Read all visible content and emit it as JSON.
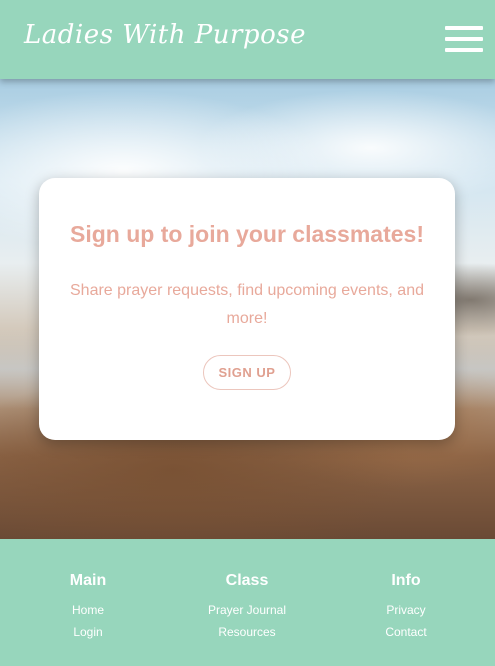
{
  "navbar": {
    "brand": "Ladies With Purpose",
    "menu_icon": "hamburger-menu-icon"
  },
  "hero": {
    "image": "beach-sunset-background"
  },
  "card": {
    "title": "Sign up to join your classmates!",
    "text": "Share prayer requests, find upcoming events, and more!",
    "button_label": "SIGN UP"
  },
  "footer": {
    "columns": [
      {
        "heading": "Main",
        "links": [
          "Home",
          "Login"
        ]
      },
      {
        "heading": "Class",
        "links": [
          "Prayer Journal",
          "Resources"
        ]
      },
      {
        "heading": "Info",
        "links": [
          "Privacy",
          "Contact"
        ]
      }
    ]
  },
  "colors": {
    "primary": "#97d6bc",
    "accent": "#e8a99b",
    "white": "#ffffff"
  }
}
